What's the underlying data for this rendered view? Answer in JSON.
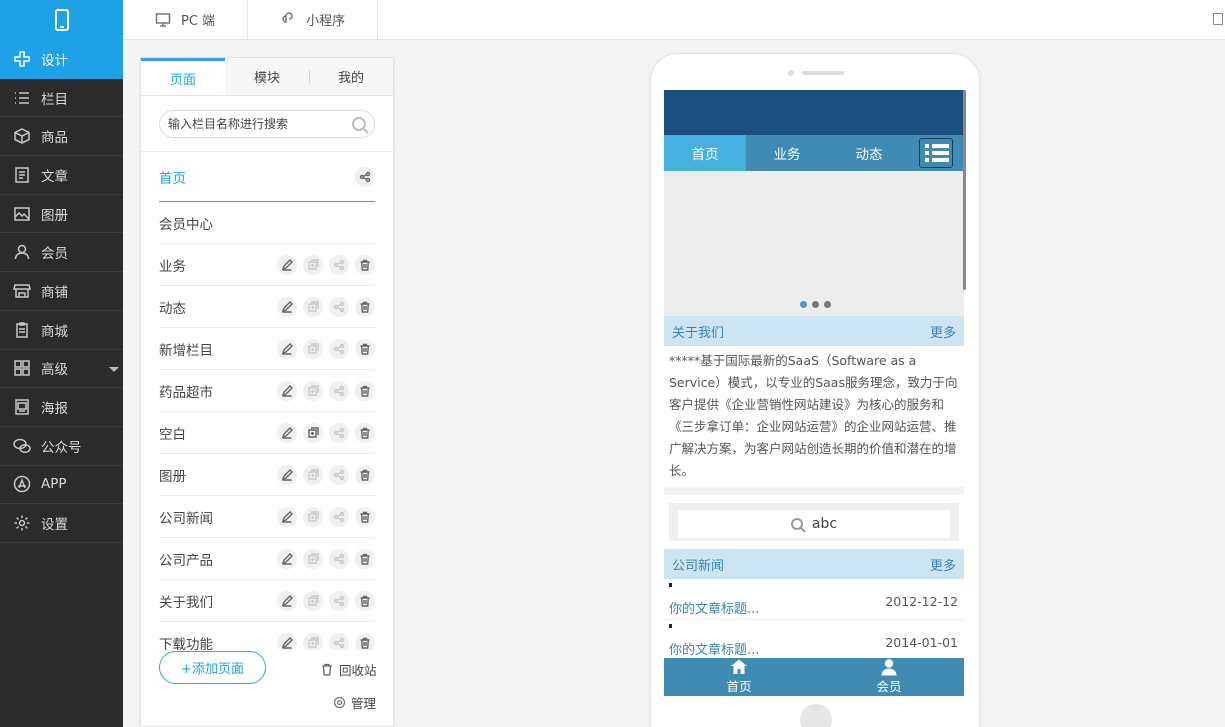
{
  "sidebar": {
    "items": [
      {
        "label": "设计",
        "icon": "design-icon",
        "active": true
      },
      {
        "label": "栏目",
        "icon": "list-icon"
      },
      {
        "label": "商品",
        "icon": "box-icon"
      },
      {
        "label": "文章",
        "icon": "article-icon"
      },
      {
        "label": "图册",
        "icon": "album-icon"
      },
      {
        "label": "会员",
        "icon": "user-icon"
      },
      {
        "label": "商铺",
        "icon": "shop-icon"
      },
      {
        "label": "商城",
        "icon": "clipboard-icon"
      },
      {
        "label": "高级",
        "icon": "grid-icon",
        "has_caret": true
      },
      {
        "label": "海报",
        "icon": "poster-icon"
      },
      {
        "label": "公众号",
        "icon": "wechat-icon"
      },
      {
        "label": "APP",
        "icon": "app-icon"
      },
      {
        "label": "设置",
        "icon": "gear-icon"
      }
    ]
  },
  "topbar": {
    "tabs": [
      {
        "label": "PC 端",
        "icon": "monitor-icon"
      },
      {
        "label": "小程序",
        "icon": "miniprogram-icon"
      }
    ]
  },
  "panel": {
    "tabs": [
      "页面",
      "模块",
      "我的"
    ],
    "active_tab": "页面",
    "search_placeholder": "输入栏目名称进行搜索",
    "pages": [
      {
        "name": "首页"
      },
      {
        "name": "会员中心"
      },
      {
        "name": "业务"
      },
      {
        "name": "动态"
      },
      {
        "name": "新增栏目"
      },
      {
        "name": "药品超市"
      },
      {
        "name": "空白"
      },
      {
        "name": "图册"
      },
      {
        "name": "公司新闻"
      },
      {
        "name": "公司产品"
      },
      {
        "name": "关于我们"
      },
      {
        "name": "下载功能"
      }
    ],
    "add_page_label": "+添加页面",
    "recycle_label": "回收站",
    "manage_label": "管理"
  },
  "preview": {
    "nav": [
      "首页",
      "业务",
      "动态"
    ],
    "active_nav": "首页",
    "about_title": "关于我们",
    "more_label": "更多",
    "about_text": "*****基于国际最新的SaaS（Software as a Service）模式，以专业的Saas服务理念，致力于向客户提供《企业营销性网站建设》为核心的服务和《三步拿订单：企业网站运营》的企业网站运营、推广解决方案，为客户网站创造长期的价值和潜在的增长。",
    "search_value": "abc",
    "news_title": "公司新闻",
    "news": [
      {
        "title": "你的文章标题...",
        "date": "2012-12-12"
      },
      {
        "title": "你的文章标题...",
        "date": "2014-01-01"
      }
    ],
    "tabbar": [
      {
        "label": "首页",
        "icon": "home-icon"
      },
      {
        "label": "会员",
        "icon": "member-icon"
      }
    ]
  },
  "colors": {
    "accent": "#1ea1e6",
    "sidebar_bg": "#2b2b2b",
    "preview_header": "#1b4f7f",
    "preview_nav": "#3f8bb4"
  }
}
